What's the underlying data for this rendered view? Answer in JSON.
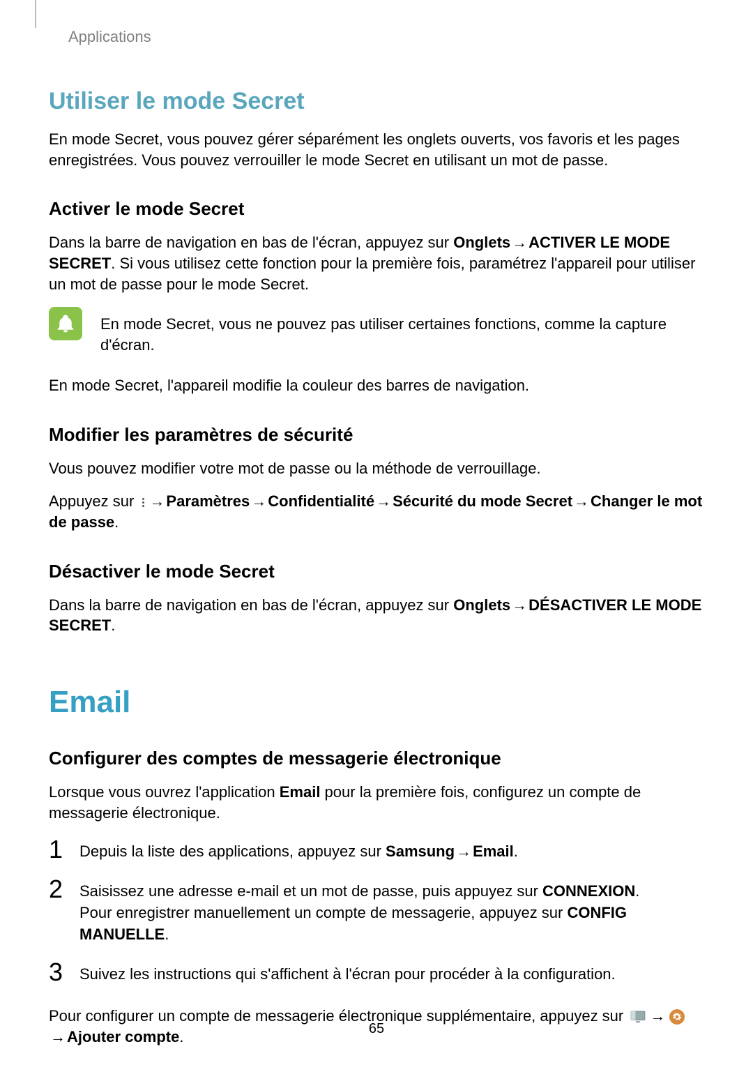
{
  "breadcrumb": "Applications",
  "page_number": "65",
  "section_secret": {
    "title": "Utiliser le mode Secret",
    "intro": "En mode Secret, vous pouvez gérer séparément les onglets ouverts, vos favoris et les pages enregistrées. Vous pouvez verrouiller le mode Secret en utilisant un mot de passe.",
    "activate_title": "Activer le mode Secret",
    "activate_para_prefix": "Dans la barre de navigation en bas de l'écran, appuyez sur ",
    "activate_bold_onglets": "Onglets",
    "arrow": " → ",
    "activate_bold_cmd": "ACTIVER LE MODE SECRET",
    "activate_para_suffix": ". Si vous utilisez cette fonction pour la première fois, paramétrez l'appareil pour utiliser un mot de passe pour le mode Secret.",
    "note": "En mode Secret, vous ne pouvez pas utiliser certaines fonctions, comme la capture d'écran.",
    "nav_color_note": "En mode Secret, l'appareil modifie la couleur des barres de navigation.",
    "modify_title": "Modifier les paramètres de sécurité",
    "modify_intro": "Vous pouvez modifier votre mot de passe ou la méthode de verrouillage.",
    "modify_prefix": "Appuyez sur ",
    "modify_path_parametres": "Paramètres",
    "modify_path_conf": "Confidentialité",
    "modify_path_secu": "Sécurité du mode Secret",
    "modify_path_change": "Changer le mot de passe",
    "period": ".",
    "deactivate_title": "Désactiver le mode Secret",
    "deactivate_prefix": "Dans la barre de navigation en bas de l'écran, appuyez sur ",
    "deactivate_bold_onglets": "Onglets",
    "deactivate_bold_cmd": "DÉSACTIVER LE MODE SECRET"
  },
  "section_email": {
    "title": "Email",
    "configure_title": "Configurer des comptes de messagerie électronique",
    "configure_intro_prefix": "Lorsque vous ouvrez l'application ",
    "configure_intro_bold": "Email",
    "configure_intro_suffix": " pour la première fois, configurez un compte de messagerie électronique.",
    "steps": [
      {
        "num": "1",
        "prefix": "Depuis la liste des applications, appuyez sur ",
        "bold1": "Samsung",
        "arrow": " → ",
        "bold2": "Email",
        "suffix": "."
      },
      {
        "num": "2",
        "line1_prefix": "Saisissez une adresse e-mail et un mot de passe, puis appuyez sur ",
        "line1_bold": "CONNEXION",
        "line1_suffix": ".",
        "line2_prefix": "Pour enregistrer manuellement un compte de messagerie, appuyez sur ",
        "line2_bold": "CONFIG MANUELLE",
        "line2_suffix": "."
      },
      {
        "num": "3",
        "text": "Suivez les instructions qui s'affichent à l'écran pour procéder à la configuration."
      }
    ],
    "additional_prefix": "Pour configurer un compte de messagerie électronique supplémentaire, appuyez sur ",
    "additional_arrow": " → ",
    "additional_bold": "Ajouter compte",
    "additional_suffix": "."
  }
}
